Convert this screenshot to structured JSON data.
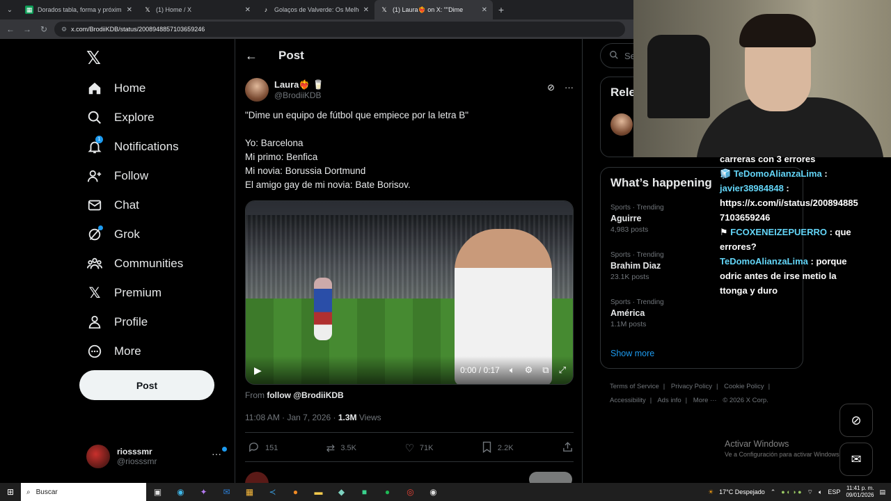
{
  "browser": {
    "tabs": [
      {
        "title": "Dorados tabla, forma y próxim",
        "icon": "sheets-icon",
        "active": false
      },
      {
        "title": "(1) Home / X",
        "icon": "x-icon",
        "active": false
      },
      {
        "title": "Golaços de Valverde: Os Melho",
        "icon": "tiktok-icon",
        "active": false
      },
      {
        "title": "(1) Laura❤️‍🔥 on X: \"\"Dime",
        "icon": "x-icon",
        "active": true
      }
    ],
    "url": "x.com/BrodiiKDB/status/2008948857103659246"
  },
  "sidebar": {
    "items": [
      {
        "label": "Home",
        "icon": "home-icon"
      },
      {
        "label": "Explore",
        "icon": "search-icon"
      },
      {
        "label": "Notifications",
        "icon": "bell-icon",
        "badge": "1"
      },
      {
        "label": "Follow",
        "icon": "person-add-icon"
      },
      {
        "label": "Chat",
        "icon": "mail-icon"
      },
      {
        "label": "Grok",
        "icon": "grok-icon"
      },
      {
        "label": "Communities",
        "icon": "communities-icon"
      },
      {
        "label": "Premium",
        "icon": "x-premium-icon"
      },
      {
        "label": "Profile",
        "icon": "person-icon"
      },
      {
        "label": "More",
        "icon": "more-circle-icon"
      }
    ],
    "post_label": "Post",
    "account": {
      "name": "riosssmr",
      "handle": "@riosssmr"
    }
  },
  "main": {
    "header_title": "Post",
    "author": {
      "name": "Laura❤️‍🔥 🥛",
      "handle": "@BrodiiKDB"
    },
    "text_lines": [
      "\"Dime un equipo de fútbol que empiece por la letra B\"",
      "",
      "Yo: Barcelona",
      "Mi primo: Benfica",
      "Mi novia: Borussia Dortmund",
      "El amigo gay de mi novia: Bate Borisov."
    ],
    "video": {
      "time": "0:00 / 0:17"
    },
    "from_prefix": "From ",
    "from_link": "follow @BrodiiKDB",
    "timestamp": "11:08 AM · Jan 7, 2026 · ",
    "views_count": "1.3M",
    "views_label": " Views",
    "stats": {
      "replies": "151",
      "reposts": "3.5K",
      "likes": "71K",
      "bookmarks": "2.2K"
    }
  },
  "right": {
    "search_placeholder": "Sea",
    "relevant_title": "Rele",
    "happening_title": "What’s happening",
    "trends": [
      {
        "category": "Sports · Trending",
        "name": "Aguirre",
        "count": "4,983 posts"
      },
      {
        "category": "Sports · Trending",
        "name": "Brahim Diaz",
        "count": "23.1K posts"
      },
      {
        "category": "Sports · Trending",
        "name": "América",
        "count": "1.1M posts"
      }
    ],
    "show_more": "Show more",
    "footer": [
      "Terms of Service",
      "|",
      "Privacy Policy",
      "|",
      "Cookie Policy",
      "|",
      "Accessibility",
      "|",
      "Ads info",
      "|",
      "More ···",
      "© 2026 X Corp."
    ]
  },
  "chat": {
    "lines": [
      {
        "user": "",
        "text": "carreras con 3 errores"
      },
      {
        "user": "TeDomoAlianzaLima",
        "text": " :"
      },
      {
        "user": "javier38984848",
        "text": " :"
      },
      {
        "user": "",
        "text": "https://x.com/i/status/200894885"
      },
      {
        "user": "",
        "text": "7103659246"
      },
      {
        "user": "FCOXENEIZEPUERRO",
        "text": " : que"
      },
      {
        "user": "",
        "text": "errores?"
      },
      {
        "user": "TeDomoAlianzaLima",
        "text": " : porque"
      },
      {
        "user": "",
        "text": "odric antes de irse metio la"
      },
      {
        "user": "",
        "text": "ttonga y duro"
      }
    ]
  },
  "windows": {
    "activate_title": "Activar Windows",
    "activate_sub": "Ve a Configuración para activar Windows.",
    "search_label": "Buscar",
    "weather": "17°C  Despejado",
    "lang": "ESP",
    "time": "11:41 p. m.",
    "date": "09/01/2026"
  }
}
